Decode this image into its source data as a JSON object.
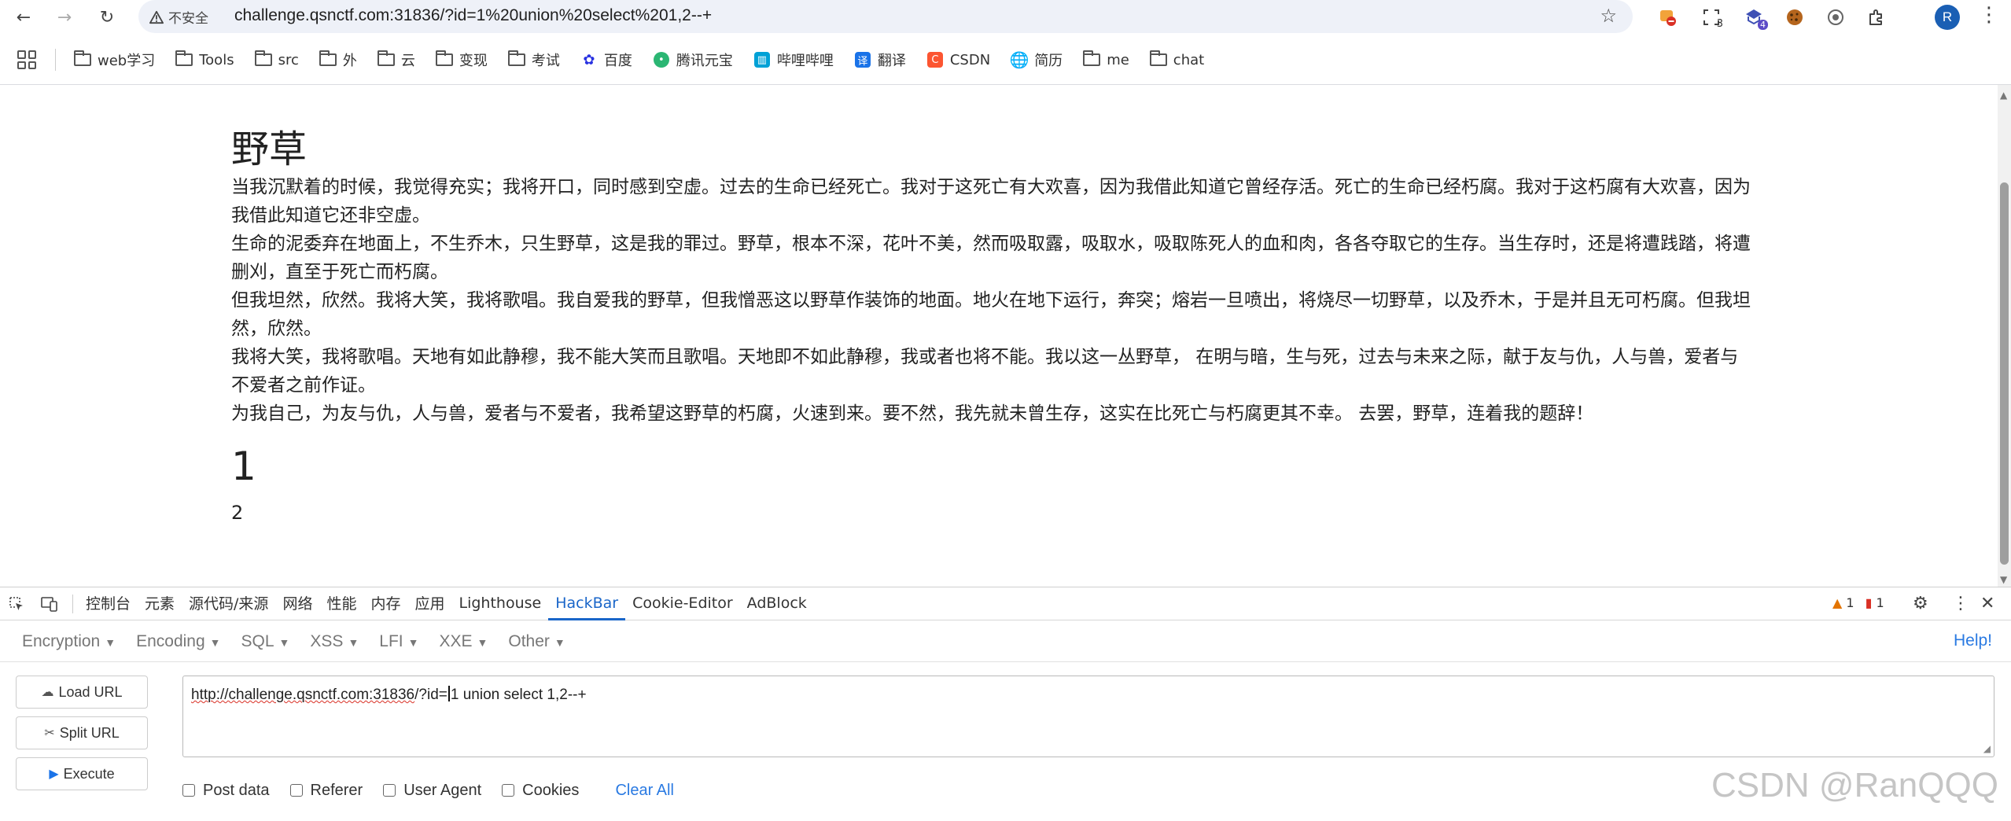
{
  "browser": {
    "security_label": "不安全",
    "url": "challenge.qsnctf.com:31836/?id=1%20union%20select%201,2--+",
    "avatar_letter": "R",
    "extensions": [
      {
        "name": "ext-blocked-icon",
        "badge": ""
      },
      {
        "name": "ext-capture-icon",
        "badge": "3"
      },
      {
        "name": "ext-shield-icon",
        "badge": "4"
      },
      {
        "name": "cookie-icon",
        "badge": ""
      },
      {
        "name": "ext-settings-icon",
        "badge": ""
      },
      {
        "name": "puzzle-icon",
        "badge": ""
      }
    ]
  },
  "bookmarks": [
    {
      "label": "web学习",
      "icon": "folder"
    },
    {
      "label": "Tools",
      "icon": "folder"
    },
    {
      "label": "src",
      "icon": "folder"
    },
    {
      "label": "外",
      "icon": "folder"
    },
    {
      "label": "云",
      "icon": "folder"
    },
    {
      "label": "变现",
      "icon": "folder"
    },
    {
      "label": "考试",
      "icon": "folder"
    },
    {
      "label": "百度",
      "icon": "baidu",
      "color": "#2932e1"
    },
    {
      "label": "腾讯元宝",
      "icon": "yuanbao",
      "color": "#2bb673"
    },
    {
      "label": "哔哩哔哩",
      "icon": "bilibili",
      "color": "#00a1d6"
    },
    {
      "label": "翻译",
      "icon": "translate",
      "color": "#1a73e8"
    },
    {
      "label": "CSDN",
      "icon": "csdn",
      "color": "#fc5531"
    },
    {
      "label": "简历",
      "icon": "globe"
    },
    {
      "label": "me",
      "icon": "folder"
    },
    {
      "label": "chat",
      "icon": "folder"
    }
  ],
  "page": {
    "title": "野草",
    "poem": [
      "当我沉默着的时候，我觉得充实；我将开口，同时感到空虚。过去的生命已经死亡。我对于这死亡有大欢喜，因为我借此知道它曾经存活。死亡的生命已经朽腐。我对于这朽腐有大欢喜，因为我借此知道它还非空虚。",
      "生命的泥委弃在地面上，不生乔木，只生野草，这是我的罪过。野草，根本不深，花叶不美，然而吸取露，吸取水，吸取陈死人的血和肉，各各夺取它的生存。当生存时，还是将遭践踏，将遭删刈，直至于死亡而朽腐。",
      "但我坦然，欣然。我将大笑，我将歌唱。我自爱我的野草，但我憎恶这以野草作装饰的地面。地火在地下运行，奔突；熔岩一旦喷出，将烧尽一切野草，以及乔木，于是并且无可朽腐。但我坦然，欣然。",
      "我将大笑，我将歌唱。天地有如此静穆，我不能大笑而且歌唱。天地即不如此静穆，我或者也将不能。我以这一丛野草， 在明与暗，生与死，过去与未来之际，献于友与仇，人与兽，爱者与不爱者之前作证。",
      "为我自己，为友与仇，人与兽，爱者与不爱者，我希望这野草的朽腐，火速到来。要不然，我先就未曾生存，这实在比死亡与朽腐更其不幸。 去罢，野草，连着我的题辞！"
    ],
    "result_1": "1",
    "result_2": "2"
  },
  "devtools": {
    "tabs": [
      "控制台",
      "元素",
      "源代码/来源",
      "网络",
      "性能",
      "内存",
      "应用",
      "Lighthouse",
      "HackBar",
      "Cookie-Editor",
      "AdBlock"
    ],
    "active_tab": "HackBar",
    "warnings": "1",
    "errors": "1"
  },
  "hackbar": {
    "menus": [
      "Encryption",
      "Encoding",
      "SQL",
      "XSS",
      "LFI",
      "XXE",
      "Other"
    ],
    "help": "Help!",
    "buttons": {
      "load": "Load URL",
      "split": "Split URL",
      "execute": "Execute"
    },
    "url_part1": "http://challenge.qsnctf.com:31836",
    "url_part2": "/?id=",
    "url_part3": "1 union select 1,2--+",
    "options": [
      "Post data",
      "Referer",
      "User Agent",
      "Cookies"
    ],
    "clear_all": "Clear All"
  },
  "watermark": "CSDN @RanQQQ"
}
